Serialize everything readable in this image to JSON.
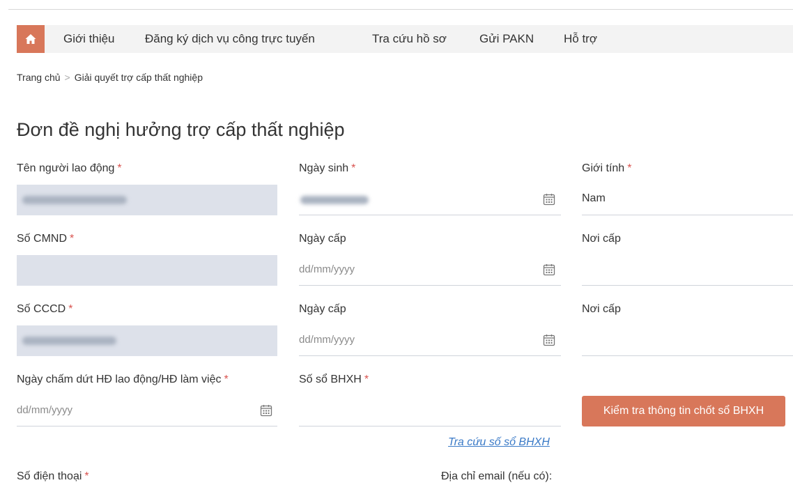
{
  "nav": {
    "items": [
      "Giới thiệu",
      "Đăng ký dịch vụ công trực tuyến",
      "Tra cứu hồ sơ",
      "Gửi PAKN",
      "Hỗ trợ"
    ]
  },
  "breadcrumb": {
    "home": "Trang chủ",
    "separator": ">",
    "current": "Giải quyết trợ cấp thất nghiệp"
  },
  "page_title": "Đơn đề nghị hưởng trợ cấp thất nghiệp",
  "required_mark": "*",
  "form": {
    "ten_nguoi_lao_dong": {
      "label": "Tên người lao động"
    },
    "ngay_sinh": {
      "label": "Ngày sinh"
    },
    "gioi_tinh": {
      "label": "Giới tính",
      "value": "Nam"
    },
    "so_cmnd": {
      "label": "Số CMND"
    },
    "ngay_cap_cmnd": {
      "label": "Ngày cấp",
      "placeholder": "dd/mm/yyyy"
    },
    "noi_cap_cmnd": {
      "label": "Nơi cấp"
    },
    "so_cccd": {
      "label": "Số CCCD"
    },
    "ngay_cap_cccd": {
      "label": "Ngày cấp",
      "placeholder": "dd/mm/yyyy"
    },
    "noi_cap_cccd": {
      "label": "Nơi cấp"
    },
    "ngay_cham_dut": {
      "label": "Ngày chấm dứt HĐ lao động/HĐ làm việc",
      "placeholder": "dd/mm/yyyy"
    },
    "so_so_bhxh": {
      "label": "Số sổ BHXH"
    },
    "so_dien_thoai": {
      "label": "Số điện thoại"
    },
    "email": {
      "label": "Địa chỉ email (nếu có):"
    }
  },
  "buttons": {
    "check_bhxh": "Kiểm tra thông tin chốt sổ BHXH"
  },
  "links": {
    "lookup_bhxh": "Tra cứu số sổ BHXH"
  },
  "colors": {
    "accent": "#d8775a",
    "required": "#d9534f",
    "disabled_field": "#dde1ea",
    "link": "#3a7ac7"
  },
  "icons": {
    "home": "home-icon",
    "calendar": "calendar-icon"
  }
}
